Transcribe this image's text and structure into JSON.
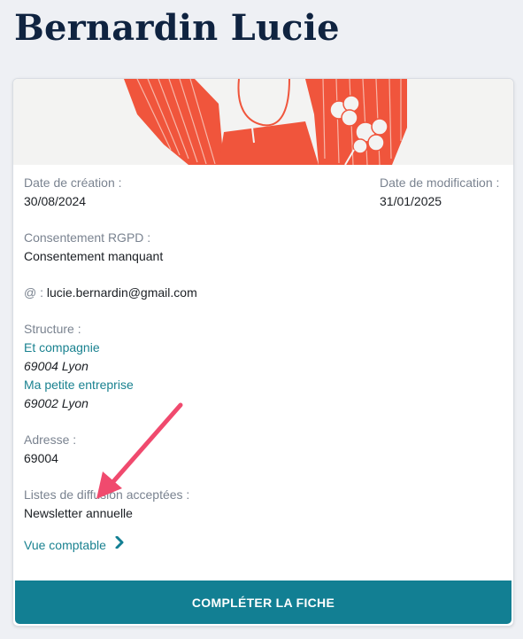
{
  "page": {
    "title": "Bernardin Lucie"
  },
  "card": {
    "created": {
      "label": "Date de création :",
      "value": "30/08/2024"
    },
    "modified": {
      "label": "Date de modification :",
      "value": "31/01/2025"
    },
    "rgpd": {
      "label": "Consentement RGPD :",
      "value": "Consentement manquant"
    },
    "email": {
      "label": "@ :",
      "value": "lucie.bernardin@gmail.com"
    },
    "structure": {
      "label": "Structure :",
      "items": [
        {
          "name": "Et compagnie",
          "city": "69004 Lyon"
        },
        {
          "name": "Ma petite entreprise",
          "city": "69002 Lyon"
        }
      ]
    },
    "address": {
      "label": "Adresse :",
      "value": "69004"
    },
    "lists": {
      "label": "Listes de diffusion acceptées :",
      "value": "Newsletter annuelle"
    },
    "accounting_link": "Vue comptable",
    "complete_button": "COMPLÉTER LA FICHE"
  },
  "colors": {
    "accent": "#127f93",
    "link": "#1a8290",
    "title": "#0f2340",
    "illustration": "#f0553c",
    "annotation_arrow": "#f04a6e"
  }
}
